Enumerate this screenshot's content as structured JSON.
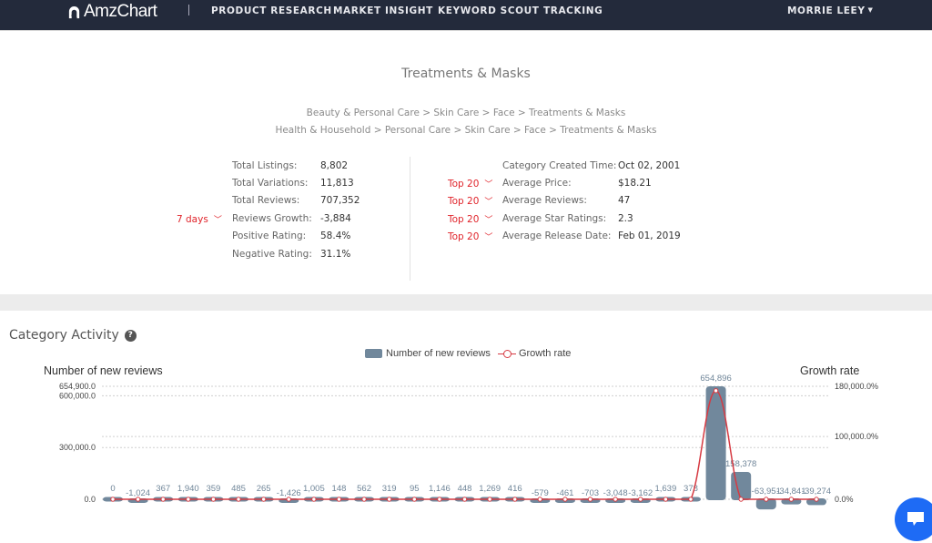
{
  "nav": {
    "brand": "AmzChart",
    "items": [
      "PRODUCT RESEARCH",
      "MARKET INSIGHT",
      "KEYWORD SCOUT",
      "TRACKING"
    ],
    "user": "MORRIE LEEY"
  },
  "category": {
    "title": "Treatments & Masks",
    "breadcrumbs": [
      "Beauty & Personal Care > Skin Care > Face > Treatments & Masks",
      "Health & Household > Personal Care > Skin Care > Face > Treatments & Masks"
    ]
  },
  "stats_left": [
    {
      "label": "Total Listings:",
      "value": "8,802"
    },
    {
      "label": "Total Variations:",
      "value": "11,813"
    },
    {
      "label": "Total Reviews:",
      "value": "707,352"
    },
    {
      "label": "Reviews Growth:",
      "value": "-3,884",
      "dropdown": "7 days"
    },
    {
      "label": "Positive Rating:",
      "value": "58.4%"
    },
    {
      "label": "Negative Rating:",
      "value": "31.1%"
    }
  ],
  "stats_right": [
    {
      "label": "Category Created Time:",
      "value": "Oct 02, 2001"
    },
    {
      "label": "Average Price:",
      "value": "$18.21",
      "dropdown": "Top 20"
    },
    {
      "label": "Average Reviews:",
      "value": "47",
      "dropdown": "Top 20"
    },
    {
      "label": "Average Star Ratings:",
      "value": "2.3",
      "dropdown": "Top 20"
    },
    {
      "label": "Average Release Date:",
      "value": "Feb 01, 2019",
      "dropdown": "Top 20"
    }
  ],
  "section": {
    "title": "Category Activity",
    "help_icon": "question-circle-icon"
  },
  "chat": {
    "icon": "chat-bubble-icon"
  },
  "colors": {
    "bar": "#71889c",
    "line": "#d63a42",
    "accent_red": "#e0242b",
    "nav_bg": "#232a3b",
    "chat": "#1e6bf5"
  },
  "chart_data": {
    "type": "bar",
    "legend": [
      "Number of new reviews",
      "Growth rate"
    ],
    "legend_position": "top-center",
    "ylabel": "Number of new reviews",
    "y2label": "Growth rate",
    "y_ticks": [
      "654,900.0",
      "600,000.0",
      "300,000.0",
      "0.0"
    ],
    "y_tick_values": [
      654900,
      600000,
      300000,
      0
    ],
    "y2_ticks": [
      "180,000.0%",
      "100,000.0%",
      "0.0%"
    ],
    "y2_tick_values": [
      180000,
      100000,
      0
    ],
    "ylim": [
      0,
      654900
    ],
    "y2lim": [
      0,
      180000
    ],
    "grid": true,
    "series": [
      {
        "name": "Number of new reviews",
        "type": "bar",
        "values": [
          0,
          -1024,
          367,
          1940,
          359,
          485,
          265,
          -1426,
          1005,
          148,
          562,
          319,
          95,
          1146,
          448,
          1269,
          416,
          -579,
          -461,
          -703,
          -3048,
          -3162,
          1639,
          378,
          654896,
          158378,
          -63951,
          -34841,
          -39274
        ],
        "labels": [
          "0",
          "-1,024",
          "367",
          "1,940",
          "359",
          "485",
          "265",
          "-1,426",
          "1,005",
          "148",
          "562",
          "319",
          "95",
          "1,146",
          "448",
          "1,269",
          "416",
          "-579",
          "-461",
          "-703",
          "-3,048",
          "-3,162",
          "1,639",
          "378",
          "654,896",
          "158,378",
          "-63,951",
          "-34,841",
          "-39,274"
        ]
      },
      {
        "name": "Growth rate",
        "type": "line",
        "axis": "right",
        "values": [
          0,
          0,
          0,
          0,
          0,
          0,
          0,
          0,
          0,
          0,
          0,
          0,
          0,
          0,
          0,
          0,
          0,
          0,
          0,
          0,
          0,
          0,
          0,
          0,
          173000,
          0,
          0,
          0,
          0
        ]
      }
    ]
  }
}
